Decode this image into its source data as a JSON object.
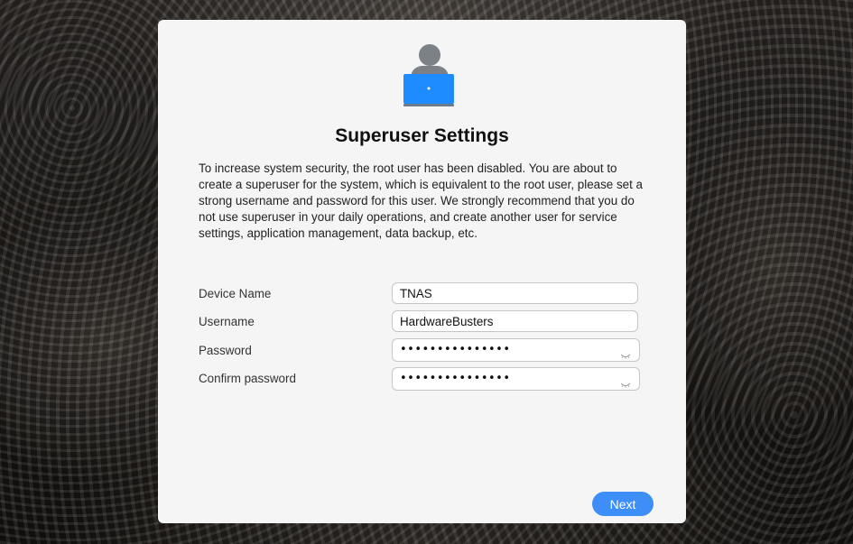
{
  "dialog": {
    "title": "Superuser Settings",
    "description": "To increase system security, the root user has been disabled. You are about to create a superuser for the system, which is equivalent to the root user, please set a strong username and password for this user. We strongly recommend that you do not use superuser in your daily operations, and create another user for service settings, application management, data backup, etc.",
    "avatar_icon": "user-with-laptop-icon",
    "fields": {
      "device_name": {
        "label": "Device Name",
        "value": "TNAS"
      },
      "username": {
        "label": "Username",
        "value": "HardwareBusters"
      },
      "password": {
        "label": "Password",
        "masked_value": "•••••••••••••••",
        "toggle_icon": "eye-closed-icon"
      },
      "confirm_password": {
        "label": "Confirm password",
        "masked_value": "•••••••••••••••",
        "toggle_icon": "eye-closed-icon"
      }
    },
    "next_label": "Next"
  },
  "colors": {
    "accent": "#3d8ef8",
    "avatar_laptop": "#1e8cff",
    "avatar_person": "#7c8188",
    "dialog_background": "#f5f5f5"
  }
}
